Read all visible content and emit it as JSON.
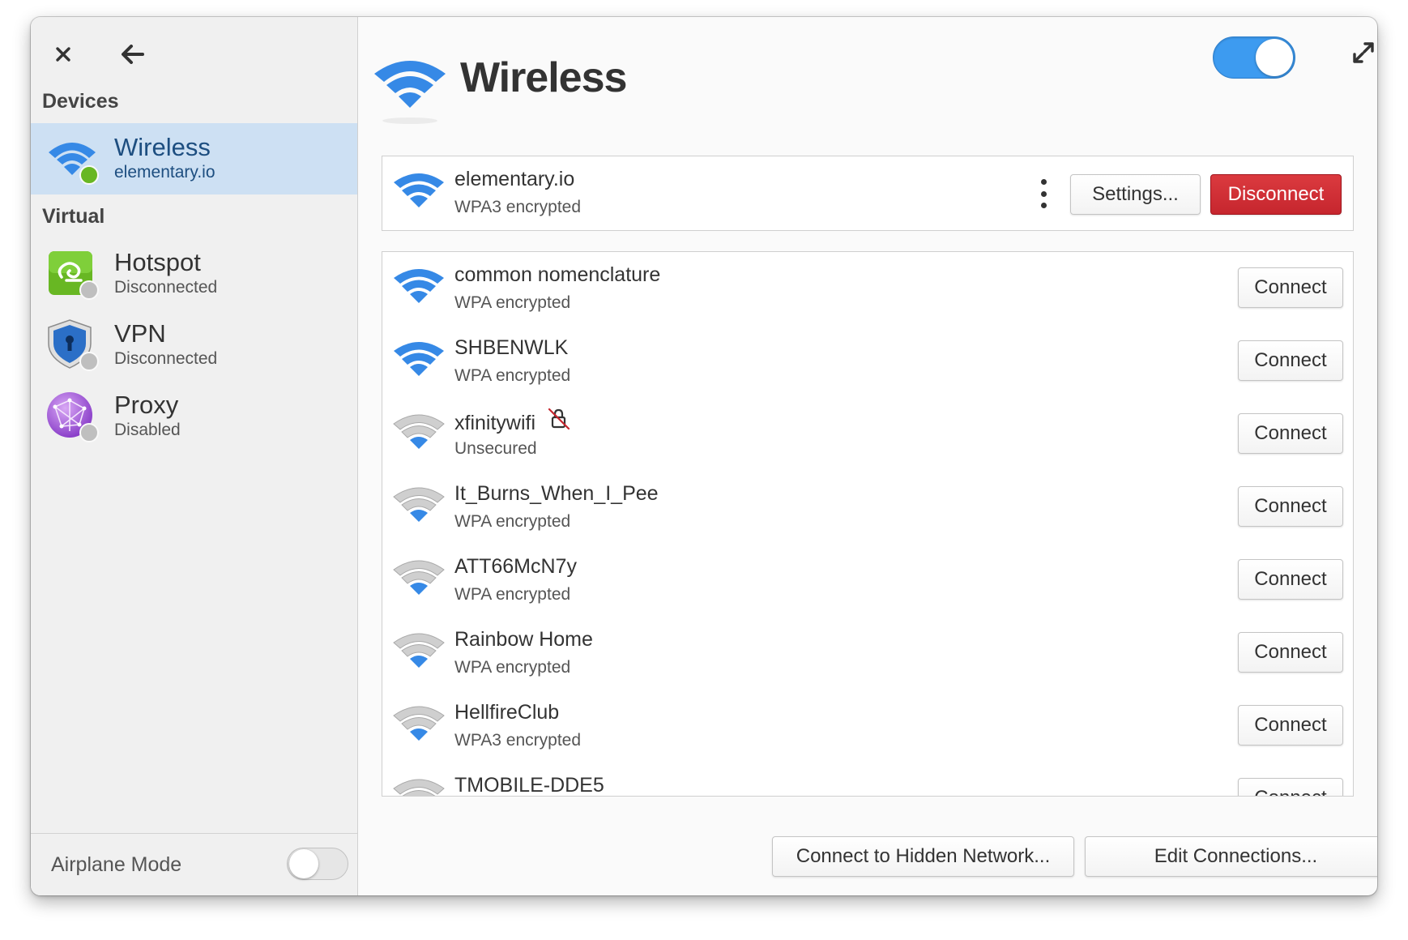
{
  "window": {
    "close_icon": "close-icon",
    "back_icon": "back-arrow-icon",
    "expand_icon": "expand-icon"
  },
  "sidebar": {
    "devices_label": "Devices",
    "virtual_label": "Virtual",
    "devices": [
      {
        "name": "Wireless",
        "sub": "elementary.io",
        "icon": "wifi-icon",
        "status_color": "#68b723"
      }
    ],
    "virtual": [
      {
        "name": "Hotspot",
        "sub": "Disconnected",
        "icon": "hotspot-icon",
        "status_color": "#bfbfbf"
      },
      {
        "name": "VPN",
        "sub": "Disconnected",
        "icon": "vpn-shield-icon",
        "status_color": "#bfbfbf"
      },
      {
        "name": "Proxy",
        "sub": "Disabled",
        "icon": "proxy-globe-icon",
        "status_color": "#bfbfbf"
      }
    ],
    "airplane_mode": {
      "label": "Airplane Mode",
      "enabled": false
    }
  },
  "main": {
    "title": "Wireless",
    "wireless_enabled": true,
    "connected": {
      "name": "elementary.io",
      "security": "WPA3 encrypted",
      "settings_label": "Settings...",
      "disconnect_label": "Disconnect"
    },
    "networks": [
      {
        "name": "common nomenclature",
        "security": "WPA encrypted",
        "strength": 4,
        "insecure": false,
        "action": "Connect"
      },
      {
        "name": "SHBENWLK",
        "security": "WPA encrypted",
        "strength": 4,
        "insecure": false,
        "action": "Connect"
      },
      {
        "name": "xfinitywifi",
        "security": "Unsecured",
        "strength": 2,
        "insecure": true,
        "action": "Connect"
      },
      {
        "name": "It_Burns_When_I_Pee",
        "security": "WPA encrypted",
        "strength": 2,
        "insecure": false,
        "action": "Connect"
      },
      {
        "name": "ATT66McN7y",
        "security": "WPA encrypted",
        "strength": 2,
        "insecure": false,
        "action": "Connect"
      },
      {
        "name": "Rainbow Home",
        "security": "WPA encrypted",
        "strength": 2,
        "insecure": false,
        "action": "Connect"
      },
      {
        "name": "HellfireClub",
        "security": "WPA3 encrypted",
        "strength": 1,
        "insecure": false,
        "action": "Connect"
      },
      {
        "name": "TMOBILE-DDE5",
        "security": "",
        "strength": 1,
        "insecure": false,
        "action": "Connect"
      }
    ],
    "hidden_network_label": "Connect to Hidden Network...",
    "edit_connections_label": "Edit Connections...",
    "colors": {
      "accent": "#3d9bf0",
      "destructive": "#c6262e",
      "selected": "#cde0f3"
    }
  }
}
